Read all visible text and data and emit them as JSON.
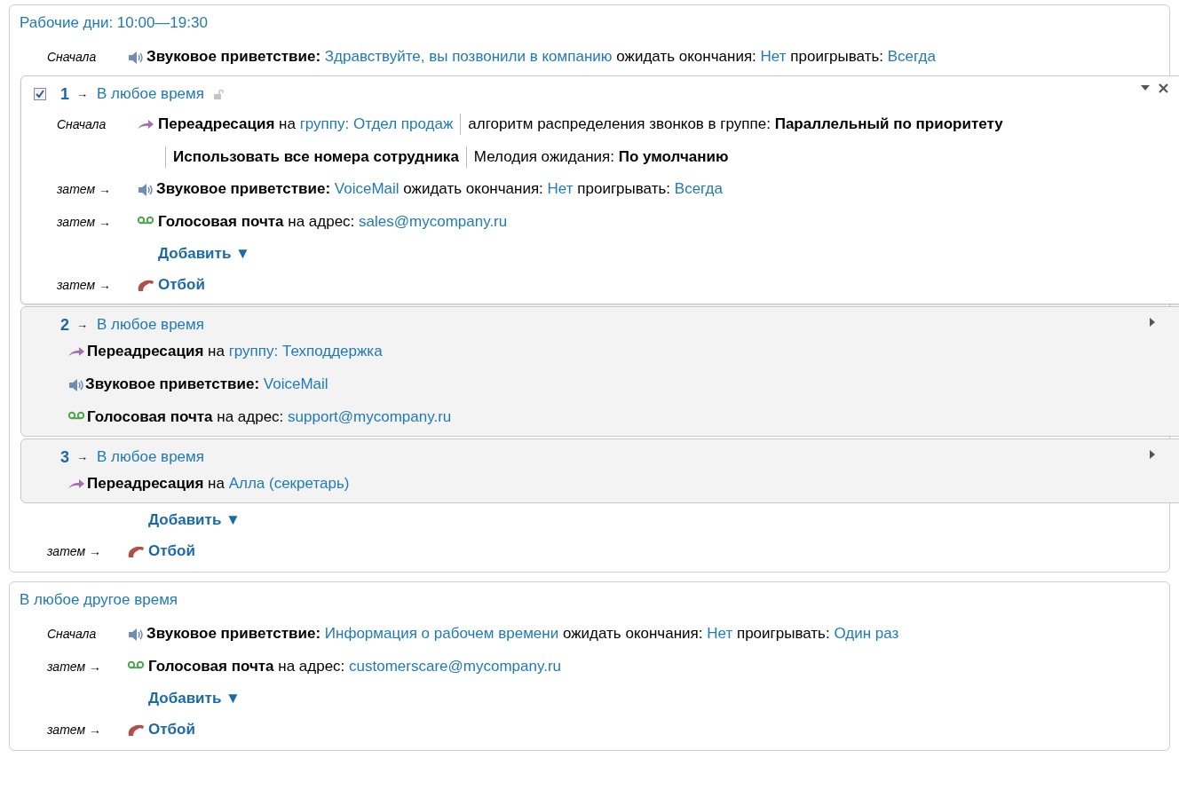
{
  "sections": [
    {
      "title": "Рабочие дни: 10:00—19:30",
      "items": [
        {
          "kind": "greeting",
          "prefix": "Сначала",
          "clauses": [
            [
              {
                "kind": "bold",
                "text": "Звуковое приветствие:"
              },
              {
                "kind": "link",
                "text": "Здравствуйте, вы позвонили в компанию"
              },
              {
                "kind": "plain",
                "text": "ожидать окончания:"
              },
              {
                "kind": "link",
                "text": "Нет"
              },
              {
                "kind": "plain",
                "text": "проигрывать:"
              },
              {
                "kind": "link",
                "text": "Всегда"
              }
            ]
          ]
        },
        {
          "kind": "rule",
          "number": "1",
          "arrow": "→",
          "condition": "В любое время",
          "expanded": true,
          "checked": true,
          "items": [
            {
              "kind": "forward",
              "prefix": "Сначала",
              "clauses": [
                [
                  {
                    "kind": "bold",
                    "text": "Переадресация"
                  },
                  {
                    "kind": "plain",
                    "text": "на"
                  },
                  {
                    "kind": "link",
                    "text": "группу: Отдел продаж"
                  }
                ],
                [
                  {
                    "kind": "plain",
                    "text": "алгоритм распределения звонков в группе:"
                  },
                  {
                    "kind": "bold",
                    "text": "Параллельный по приоритету"
                  }
                ],
                [
                  {
                    "kind": "bold",
                    "text": "Использовать все номера сотрудника"
                  }
                ],
                [
                  {
                    "kind": "plain",
                    "text": "Мелодия ожидания:"
                  },
                  {
                    "kind": "bold",
                    "text": "По умолчанию"
                  }
                ]
              ]
            },
            {
              "kind": "greeting",
              "prefix": "затем →",
              "clauses": [
                [
                  {
                    "kind": "bold",
                    "text": "Звуковое приветствие:"
                  },
                  {
                    "kind": "link",
                    "text": "VoiceMail"
                  },
                  {
                    "kind": "plain",
                    "text": "ожидать окончания:"
                  },
                  {
                    "kind": "link",
                    "text": "Нет"
                  },
                  {
                    "kind": "plain",
                    "text": "проигрывать:"
                  },
                  {
                    "kind": "link",
                    "text": "Всегда"
                  }
                ]
              ]
            },
            {
              "kind": "voicemail",
              "prefix": "затем →",
              "clauses": [
                [
                  {
                    "kind": "bold",
                    "text": "Голосовая почта"
                  },
                  {
                    "kind": "plain",
                    "text": "на адрес:"
                  },
                  {
                    "kind": "link",
                    "text": "sales@mycompany.ru"
                  }
                ]
              ]
            },
            {
              "kind": "add",
              "label": "Добавить",
              "caret": "▼"
            },
            {
              "kind": "hangup",
              "prefix": "затем →",
              "clauses": [
                [
                  {
                    "kind": "action",
                    "text": "Отбой"
                  }
                ]
              ]
            }
          ]
        },
        {
          "kind": "rule",
          "number": "2",
          "arrow": "→",
          "condition": "В любое время",
          "expanded": false,
          "items": [
            {
              "kind": "forward",
              "clauses": [
                [
                  {
                    "kind": "bold",
                    "text": "Переадресация"
                  },
                  {
                    "kind": "plain",
                    "text": "на"
                  },
                  {
                    "kind": "link",
                    "text": "группу: Техподдержка"
                  }
                ]
              ]
            },
            {
              "kind": "greeting",
              "clauses": [
                [
                  {
                    "kind": "bold",
                    "text": "Звуковое приветствие:"
                  },
                  {
                    "kind": "link",
                    "text": "VoiceMail"
                  }
                ]
              ]
            },
            {
              "kind": "voicemail",
              "clauses": [
                [
                  {
                    "kind": "bold",
                    "text": "Голосовая почта"
                  },
                  {
                    "kind": "plain",
                    "text": "на адрес:"
                  },
                  {
                    "kind": "link",
                    "text": "support@mycompany.ru"
                  }
                ]
              ]
            }
          ]
        },
        {
          "kind": "rule",
          "number": "3",
          "arrow": "→",
          "condition": "В любое время",
          "expanded": false,
          "items": [
            {
              "kind": "forward",
              "clauses": [
                [
                  {
                    "kind": "bold",
                    "text": "Переадресация"
                  },
                  {
                    "kind": "plain",
                    "text": "на"
                  },
                  {
                    "kind": "link",
                    "text": "Алла (секретарь)"
                  }
                ]
              ]
            }
          ]
        },
        {
          "kind": "add",
          "label": "Добавить",
          "caret": "▼"
        },
        {
          "kind": "hangup",
          "prefix": "затем →",
          "clauses": [
            [
              {
                "kind": "action",
                "text": "Отбой"
              }
            ]
          ]
        }
      ]
    },
    {
      "title": "В любое другое время",
      "items": [
        {
          "kind": "greeting",
          "prefix": "Сначала",
          "clauses": [
            [
              {
                "kind": "bold",
                "text": "Звуковое приветствие:"
              },
              {
                "kind": "link",
                "text": "Информация о рабочем времени"
              },
              {
                "kind": "plain",
                "text": "ожидать окончания:"
              },
              {
                "kind": "link",
                "text": "Нет"
              },
              {
                "kind": "plain",
                "text": "проигрывать:"
              },
              {
                "kind": "link",
                "text": "Один раз"
              }
            ]
          ]
        },
        {
          "kind": "voicemail",
          "prefix": "затем →",
          "clauses": [
            [
              {
                "kind": "bold",
                "text": "Голосовая почта"
              },
              {
                "kind": "plain",
                "text": "на адрес:"
              },
              {
                "kind": "link",
                "text": "customerscare@mycompany.ru"
              }
            ]
          ]
        },
        {
          "kind": "add",
          "label": "Добавить",
          "caret": "▼"
        },
        {
          "kind": "hangup",
          "prefix": "затем →",
          "clauses": [
            [
              {
                "kind": "action",
                "text": "Отбой"
              }
            ]
          ]
        }
      ]
    }
  ]
}
